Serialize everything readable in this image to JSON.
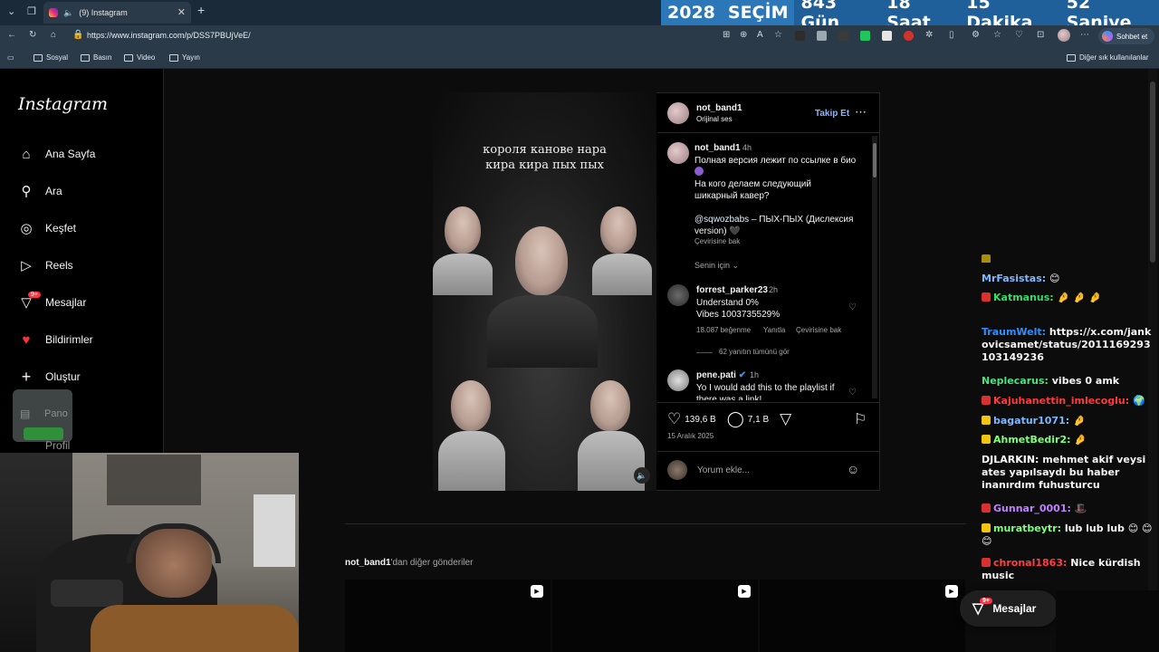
{
  "browser": {
    "tab_title": "(9) Instagram",
    "url": "https://www.instagram.com/p/DSS7PBUjVeE/",
    "bookmarks": [
      "Sosyal",
      "Basın",
      "Video",
      "Yayın"
    ],
    "other_bookmarks": "Diğer sık kullanılanlar",
    "chat_button": "Sohbet et"
  },
  "countdown": {
    "year": "2028",
    "label": "SEÇİM",
    "days": "843 Gün",
    "hours": "18 Saat",
    "minutes": "15 Dakika",
    "seconds": "52 Saniye"
  },
  "sidebar": {
    "logo": "Instagram",
    "items": [
      {
        "label": "Ana Sayfa",
        "icon": "home-icon"
      },
      {
        "label": "Ara",
        "icon": "search-icon"
      },
      {
        "label": "Keşfet",
        "icon": "compass-icon"
      },
      {
        "label": "Reels",
        "icon": "reels-icon"
      },
      {
        "label": "Mesajlar",
        "icon": "messenger-icon",
        "badge": "9+"
      },
      {
        "label": "Bildirimler",
        "icon": "heart-icon"
      },
      {
        "label": "Oluştur",
        "icon": "plus-icon"
      },
      {
        "label": "Pano",
        "icon": "dashboard-icon"
      },
      {
        "label": "Profil",
        "icon": "profile-icon"
      }
    ]
  },
  "post": {
    "author": "not_band1",
    "audio": "Orijinal ses",
    "follow": "Takip Et",
    "caption_lines": [
      "короля канове нара",
      "кира кира пых пых"
    ],
    "caption_comment": {
      "user": "not_band1",
      "time": "4h",
      "line1": "Полная версия лежит по ссылке в био",
      "line2": "На кого делаем следующий",
      "line3": "шикарный кавер?",
      "mention": "@sqwozbabs",
      "line4": " – ПЫХ-ПЫХ (Дислексия",
      "line5": "version) 🖤",
      "translate": "Çevirisine bak"
    },
    "sort_label": "Senin için",
    "comments": [
      {
        "user": "forrest_parker23",
        "time": "2h",
        "line1": "Understand 0%",
        "line2": "Vibes 1003735529%",
        "likes": "18.087 beğenme",
        "reply": "Yanıtla",
        "translate": "Çevirisine bak",
        "view_replies": "62 yanıtın tümünü gör"
      },
      {
        "user": "pene.pati",
        "time": "1h",
        "line1": "Yo I would add this to the playlist if",
        "line2": "there was a link!"
      }
    ],
    "like_count": "139,6 B",
    "comment_count": "7,1 B",
    "date": "15 Aralık 2025",
    "add_comment_placeholder": "Yorum ekle..."
  },
  "more_posts": {
    "user": "not_band1",
    "suffix": "'dan diğer gönderiler"
  },
  "chat": [
    {
      "user": "MrFasistas:",
      "msg": "😊",
      "color": "#7fb8ff"
    },
    {
      "user": "Katmanus:",
      "msg": "🤌 🤌 🤌",
      "color": "#33dd66"
    },
    {
      "user": "TraumWelt:",
      "msg": "https://x.com/jankovicsamet/status/2011169293103149236",
      "color": "#2f8fff"
    },
    {
      "user": "Neplecarus:",
      "msg": "vibes 0 amk",
      "color": "#50e080"
    },
    {
      "user": "Kajuhanettin_imlecoglu:",
      "msg": "🌍",
      "color": "#ff3a3a"
    },
    {
      "user": "bagatur1071:",
      "msg": "🤌",
      "color": "#7fb8ff"
    },
    {
      "user": "AhmetBedir2:",
      "msg": "🤌",
      "color": "#7dff7d"
    },
    {
      "user": "DJLARKIN:",
      "msg": "mehmet akif veysi ates yapılsaydı bu haber inanırdım fuhusturcu",
      "color": "#ffffff"
    },
    {
      "user": "Gunnar_0001:",
      "msg": "🎩",
      "color": "#c080ff"
    },
    {
      "user": "muratbeytr:",
      "msg": "lub lub lub 😊 😊 😊",
      "color": "#7dff7d"
    },
    {
      "user": "chronal1863:",
      "msg": "Nice kürdish music",
      "color": "#ff4040"
    }
  ],
  "messages_pill": {
    "label": "Mesajlar",
    "badge": "9+"
  }
}
